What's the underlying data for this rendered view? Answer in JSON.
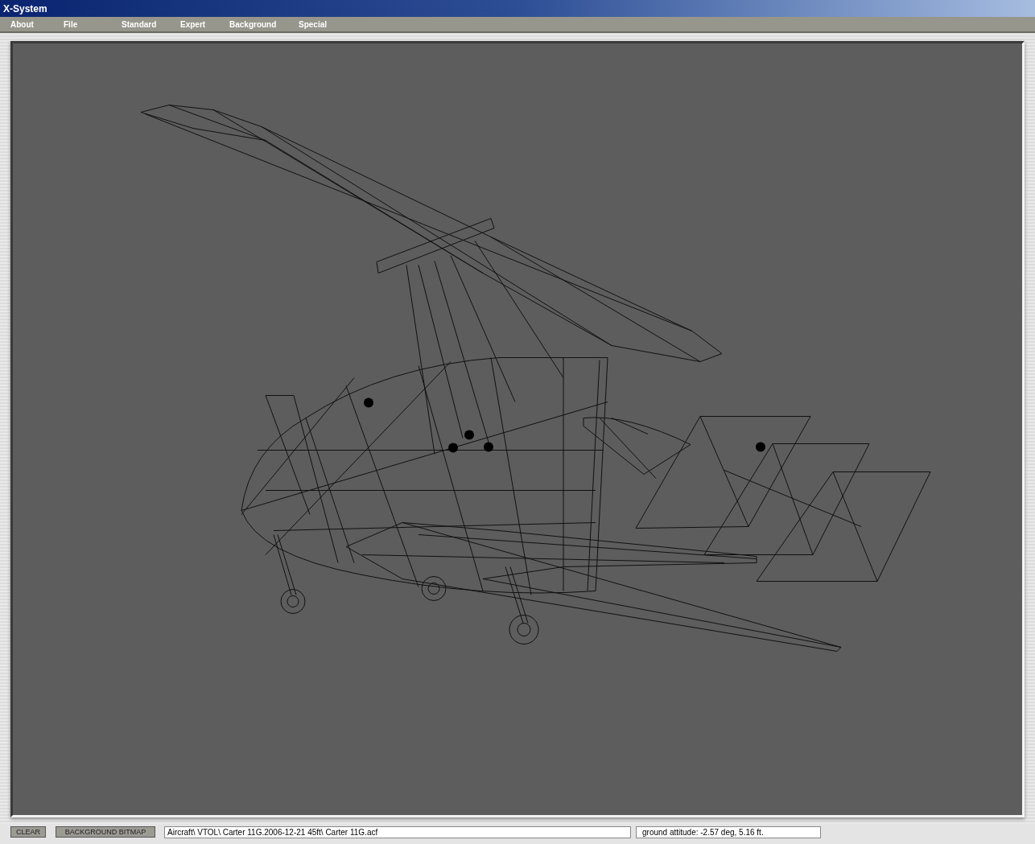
{
  "window": {
    "title": "X-System"
  },
  "menu": [
    {
      "label": "About"
    },
    {
      "label": "File"
    },
    {
      "label": "Standard"
    },
    {
      "label": "Expert"
    },
    {
      "label": "Background"
    },
    {
      "label": "Special"
    }
  ],
  "buttons": [
    {
      "label": "CLEAR"
    },
    {
      "label": "BACKGROUND BITMAP"
    }
  ],
  "path_field": {
    "value": "Aircraft\\ VTOL\\ Carter 11G.2006-12-21 45ft\\ Carter 11G.acf"
  },
  "status": {
    "text": "ground attitude: -2.57 deg, 5.16 ft."
  }
}
